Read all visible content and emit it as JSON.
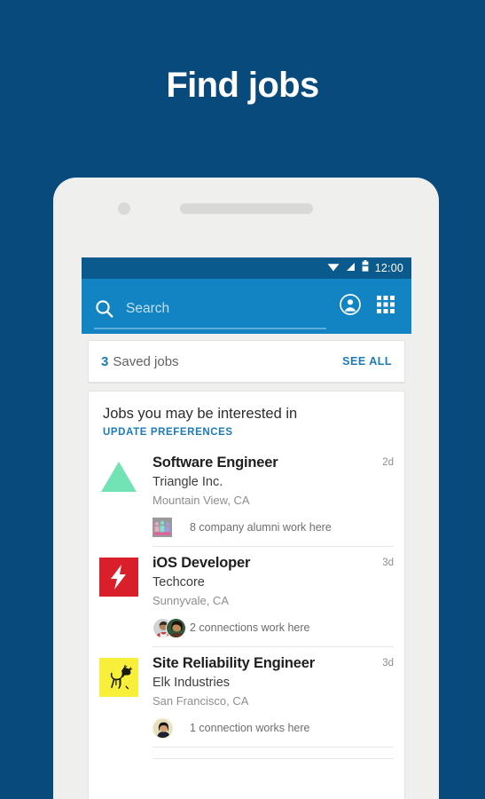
{
  "hero": {
    "title": "Find jobs",
    "background_color": "#084a7c"
  },
  "device": {
    "frame_color": "#efefee",
    "camera_icon": "camera-dot",
    "speaker_icon": "speaker-grill"
  },
  "statusbar": {
    "wifi_icon": "wifi-icon",
    "signal_icon": "cellular-signal-icon",
    "battery_icon": "battery-icon",
    "time": "12:00",
    "background_color": "#0a5a8e"
  },
  "appbar": {
    "background_color": "#1283c3",
    "search_icon": "search-icon",
    "search_value": "",
    "search_placeholder": "Search",
    "profile_icon": "profile-circle-icon",
    "grid_icon": "app-grid-icon"
  },
  "saved_jobs": {
    "count": "3",
    "label": "Saved jobs",
    "see_all_label": "SEE ALL",
    "accent_color": "#1b7bb9"
  },
  "jobs_section": {
    "title": "Jobs you may be interested in",
    "update_preferences_label": "UPDATE PREFERENCES",
    "items": [
      {
        "title": "Software Engineer",
        "company": "Triangle Inc.",
        "location": "Mountain View, CA",
        "age": "2d",
        "logo_icon": "triangle-logo-icon",
        "logo_color": "#72e3b4",
        "social_icon": "alumni-group-icon",
        "social_text": "8 company alumni work here"
      },
      {
        "title": "iOS Developer",
        "company": "Techcore",
        "location": "Sunnyvale, CA",
        "age": "3d",
        "logo_icon": "lightning-bolt-logo-icon",
        "logo_color": "#d81f2a",
        "social_icon": "two-connection-avatars-icon",
        "social_text": "2 connections work here"
      },
      {
        "title": "Site Reliability Engineer",
        "company": "Elk Industries",
        "location": "San Francisco, CA",
        "age": "3d",
        "logo_icon": "elk-logo-icon",
        "logo_color": "#f7ef3a",
        "social_icon": "one-connection-avatar-icon",
        "social_text": "1 connection works here"
      }
    ]
  }
}
